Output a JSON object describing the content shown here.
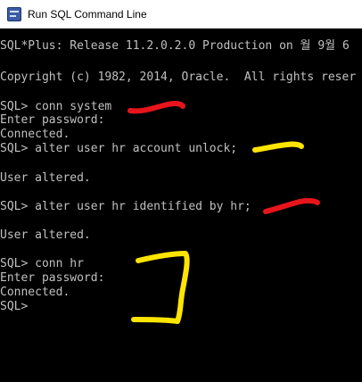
{
  "window": {
    "title": "Run SQL Command Line",
    "icon": "sql-plus-icon"
  },
  "console": {
    "lines": [
      "SQL*Plus: Release 11.2.0.2.0 Production on 월 9월 6",
      "Copyright (c) 1982, 2014, Oracle.  All rights reser",
      "SQL> conn system",
      "Enter password:",
      "Connected.",
      "SQL> alter user hr account unlock;",
      "User altered.",
      "SQL> alter user hr identified by hr;",
      "User altered.",
      "SQL> conn hr",
      "Enter password:",
      "Connected.",
      "SQL>"
    ]
  },
  "colors": {
    "console_background": "#000000",
    "console_text": "#c0c0c0",
    "annotation_red": "#e8141c",
    "annotation_yellow": "#ffe500"
  }
}
